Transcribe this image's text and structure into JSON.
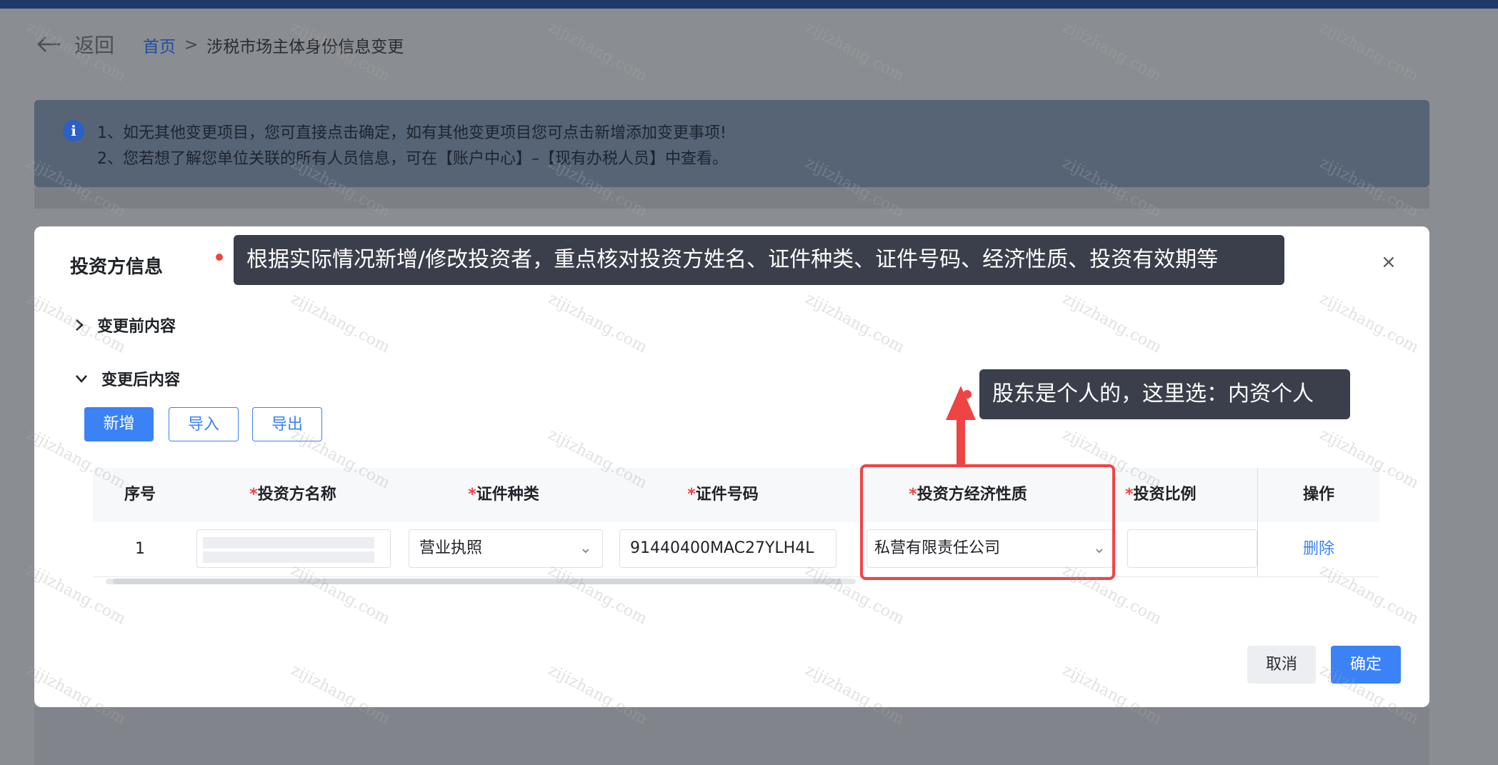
{
  "header": {
    "back_label": "返回",
    "breadcrumb_home": "首页",
    "breadcrumb_sep": ">",
    "breadcrumb_current": "涉税市场主体身份信息变更"
  },
  "notice": {
    "line1": "1、如无其他变更项目，您可直接点击确定，如有其他变更项目您可点击新增添加变更事项!",
    "line2": "2、您若想了解您单位关联的所有人员信息，可在【账户中心】–【现有办税人员】中查看。"
  },
  "modal": {
    "title": "投资方信息",
    "close": "×",
    "tip_top": "根据实际情况新增/修改投资者，重点核对投资方姓名、证件种类、证件号码、经济性质、投资有效期等",
    "section_before": "变更前内容",
    "section_after": "变更后内容",
    "buttons": {
      "add": "新增",
      "import": "导入",
      "export": "导出"
    },
    "tip_right": "股东是个人的，这里选：内资个人",
    "table": {
      "headers": {
        "index": "序号",
        "name": "投资方名称",
        "id_type": "证件种类",
        "id_number": "证件号码",
        "nature": "投资方经济性质",
        "ratio": "投资比例",
        "op": "操作"
      },
      "required_mark": "*",
      "rows": [
        {
          "index": "1",
          "id_type": "营业执照",
          "id_number": "91440400MAC27YLH4L",
          "nature": "私营有限责任公司",
          "op": "删除"
        }
      ]
    },
    "footer": {
      "cancel": "取消",
      "confirm": "确定"
    }
  },
  "watermark": "zijizhang.com",
  "colors": {
    "primary": "#3b82f6",
    "highlight": "#ef4444",
    "tooltip": "#3a3f4b",
    "topbar": "#1e3a6b"
  }
}
